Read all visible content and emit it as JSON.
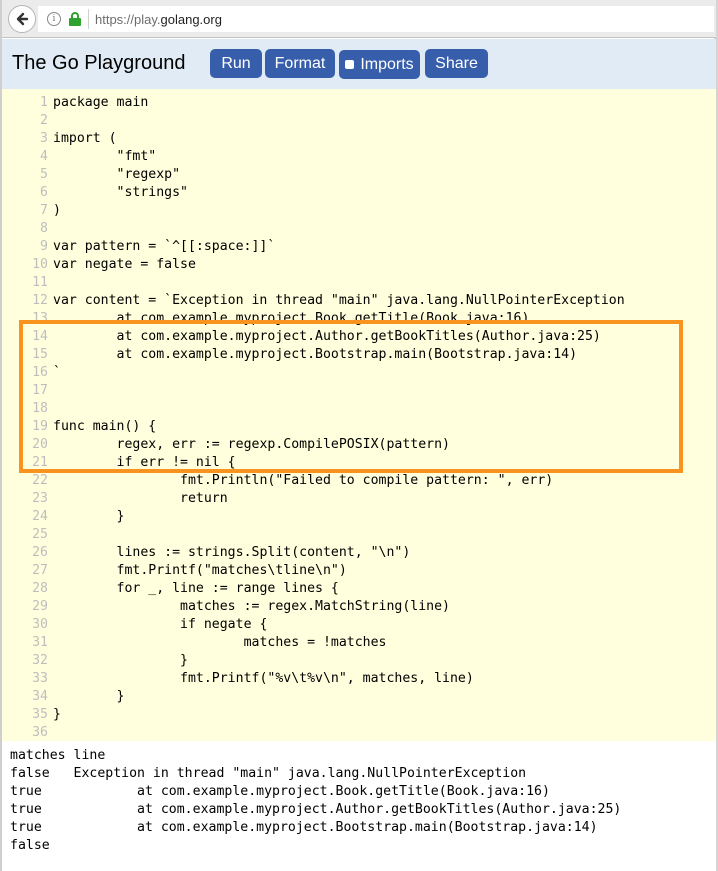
{
  "browser": {
    "url_prefix": "https://play.",
    "url_domain": "golang.org",
    "back_icon": "arrow-left",
    "info_icon": "i",
    "lock_icon": "lock"
  },
  "header": {
    "title": "The Go Playground",
    "buttons": {
      "run": "Run",
      "format": "Format",
      "imports": "Imports",
      "share": "Share"
    },
    "imports_checked": false
  },
  "colors": {
    "button_bg": "#375eab",
    "header_bg": "#e0ebf5",
    "editor_bg": "#ffffdd",
    "highlight_border": "#f7931e",
    "line_number": "#bebebe"
  },
  "editor": {
    "lines": [
      "package main",
      "",
      "import (",
      "\t\"fmt\"",
      "\t\"regexp\"",
      "\t\"strings\"",
      ")",
      "",
      "var pattern = `^[[:space:]]`",
      "var negate = false",
      "",
      "var content = `Exception in thread \"main\" java.lang.NullPointerException",
      "\tat com.example.myproject.Book.getTitle(Book.java:16)",
      "\tat com.example.myproject.Author.getBookTitles(Author.java:25)",
      "\tat com.example.myproject.Bootstrap.main(Bootstrap.java:14)",
      "`",
      "",
      "",
      "func main() {",
      "\tregex, err := regexp.CompilePOSIX(pattern)",
      "\tif err != nil {",
      "\t\tfmt.Println(\"Failed to compile pattern: \", err)",
      "\t\treturn",
      "\t}",
      "",
      "\tlines := strings.Split(content, \"\\n\")",
      "\tfmt.Printf(\"matches\\tline\\n\")",
      "\tfor _, line := range lines {",
      "\t\tmatches := regex.MatchString(line)",
      "\t\tif negate {",
      "\t\t\tmatches = !matches",
      "\t\t}",
      "\t\tfmt.Printf(\"%v\\t%v\\n\", matches, line)",
      "\t}",
      "}",
      ""
    ],
    "highlighted_lines": [
      9,
      16
    ]
  },
  "output": {
    "lines": [
      "matches line",
      "false\tException in thread \"main\" java.lang.NullPointerException",
      "true\t\tat com.example.myproject.Book.getTitle(Book.java:16)",
      "true\t\tat com.example.myproject.Author.getBookTitles(Author.java:25)",
      "true\t\tat com.example.myproject.Bootstrap.main(Bootstrap.java:14)",
      "false"
    ]
  }
}
